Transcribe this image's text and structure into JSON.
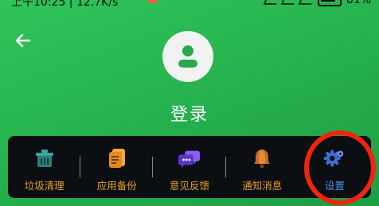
{
  "status_bar": {
    "left_text": "上午10:25 | 12.7K/s",
    "battery_percent": "81%"
  },
  "header": {
    "back_icon": "arrow-left-icon",
    "avatar_icon": "user-icon",
    "login_label": "登录"
  },
  "menu": {
    "items": [
      {
        "label": "垃圾清理",
        "icon": "trash-basket-icon"
      },
      {
        "label": "应用备份",
        "icon": "backup-document-icon"
      },
      {
        "label": "意见反馈",
        "icon": "chat-bubble-icon"
      },
      {
        "label": "通知消息",
        "icon": "bell-icon"
      },
      {
        "label": "设置",
        "icon": "gear-icon"
      }
    ]
  },
  "colors": {
    "background": "#27b34f",
    "menu_bg": "#0c0f12",
    "label_gold": "#e4a12a",
    "label_blue": "#4e8ef0",
    "highlight_ring": "#f0250f"
  }
}
